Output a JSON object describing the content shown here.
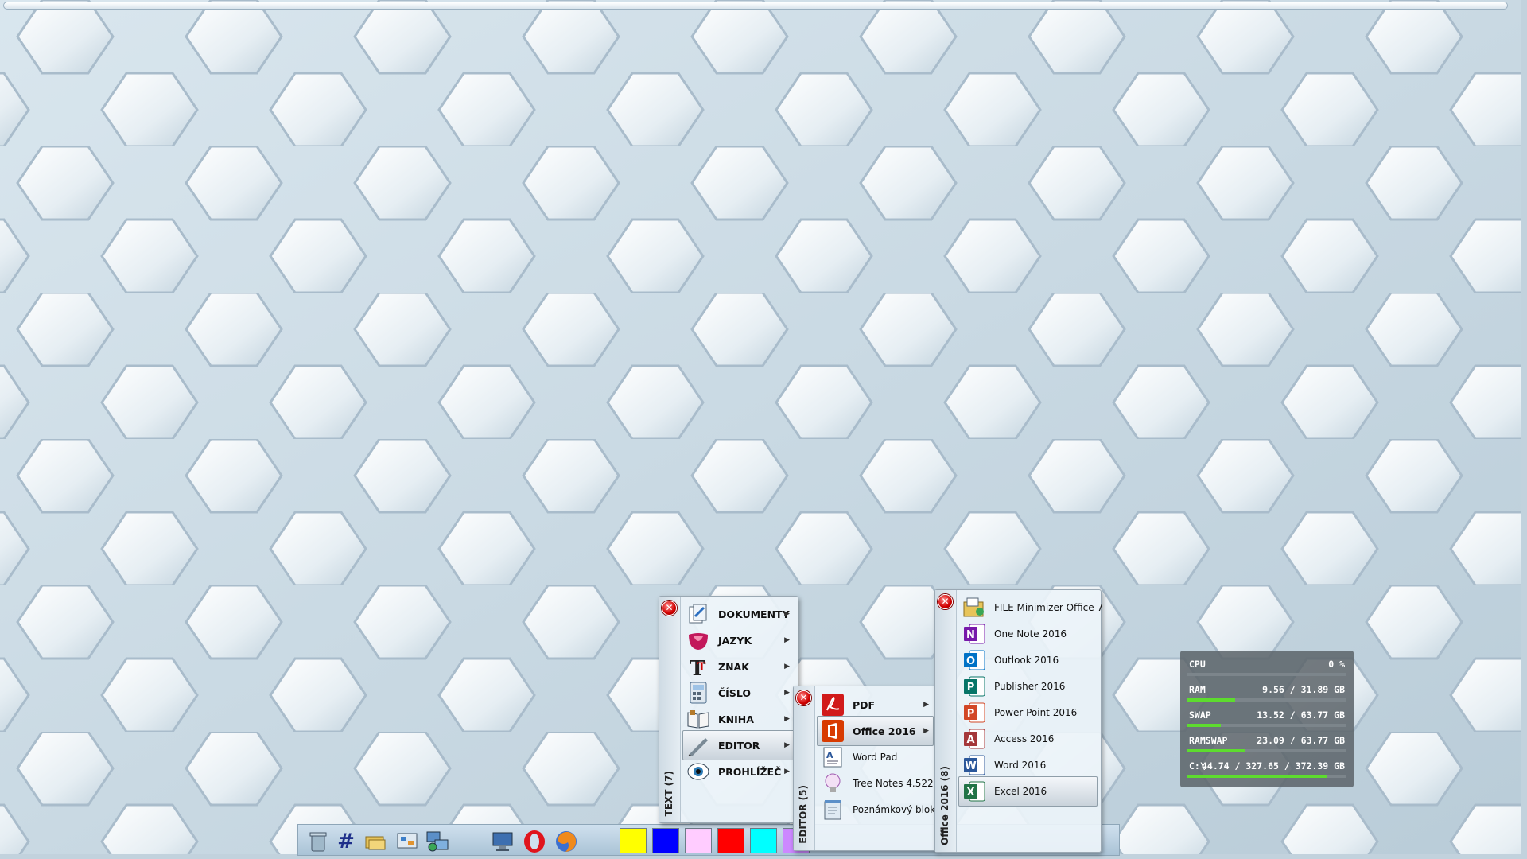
{
  "menu_text": {
    "title": "TEXT (7)",
    "items": [
      {
        "label": "DOKUMENTY",
        "icon": "documents-icon"
      },
      {
        "label": "JAZYK",
        "icon": "tongue-icon"
      },
      {
        "label": "ZNAK",
        "icon": "character-icon"
      },
      {
        "label": "ČÍSLO",
        "icon": "calculator-icon"
      },
      {
        "label": "KNIHA",
        "icon": "book-icon"
      },
      {
        "label": "EDITOR",
        "icon": "pen-icon",
        "selected": true
      },
      {
        "label": "PROHLÍŽEČ",
        "icon": "eye-icon"
      }
    ]
  },
  "menu_editor": {
    "title": "EDITOR (5)",
    "items": [
      {
        "label": "PDF",
        "icon": "pdf-icon"
      },
      {
        "label": "Office 2016",
        "icon": "office-icon",
        "selected": true
      },
      {
        "label": "Word Pad",
        "icon": "wordpad-icon"
      },
      {
        "label": "Tree Notes 4.522 #",
        "icon": "lightbulb-icon"
      },
      {
        "label": "Poznámkový blok",
        "icon": "notepad-icon"
      }
    ]
  },
  "menu_office": {
    "title": "Office 2016 (8)",
    "items": [
      {
        "label": "FILE Minimizer Office 7",
        "icon": "file-minimizer-icon"
      },
      {
        "label": "One Note 2016",
        "icon": "onenote-icon",
        "letter": "N",
        "color": "#7719aa"
      },
      {
        "label": "Outlook 2016",
        "icon": "outlook-icon",
        "letter": "O",
        "color": "#0072c6"
      },
      {
        "label": "Publisher 2016",
        "icon": "publisher-icon",
        "letter": "P",
        "color": "#077568"
      },
      {
        "label": "Power Point 2016",
        "icon": "powerpoint-icon",
        "letter": "P",
        "color": "#d24726"
      },
      {
        "label": "Access 2016",
        "icon": "access-icon",
        "letter": "A",
        "color": "#a4373a"
      },
      {
        "label": "Word 2016",
        "icon": "word-icon",
        "letter": "W",
        "color": "#2b579a"
      },
      {
        "label": "Excel 2016",
        "icon": "excel-icon",
        "letter": "X",
        "color": "#217346",
        "selected": true
      }
    ]
  },
  "close_glyph": "✕",
  "taskbar": {
    "icons": [
      "recycle-bin-icon",
      "hash-icon",
      "folders-icon",
      "control-panel-icon",
      "network-icon",
      "computer-icon",
      "opera-icon",
      "firefox-icon"
    ],
    "swatches": [
      "#ffff00",
      "#0000ff",
      "#ffccff",
      "#ff0000",
      "#00ffff",
      "#cc88ff"
    ]
  },
  "resources": [
    {
      "name": "CPU",
      "value": "0 %",
      "fill": 0.0
    },
    {
      "name": "RAM",
      "value": "9.56 / 31.89 GB",
      "fill": 0.3
    },
    {
      "name": "SWAP",
      "value": "13.52 / 63.77 GB",
      "fill": 0.21
    },
    {
      "name": "RAMSWAP",
      "value": "23.09 / 63.77 GB",
      "fill": 0.36
    },
    {
      "name": "C:\\",
      "value": "44.74 / 327.65 / 372.39 GB",
      "fill": 0.88
    }
  ],
  "colors": {
    "accent_green": "#5ddc2e",
    "close_red": "#d00000"
  }
}
